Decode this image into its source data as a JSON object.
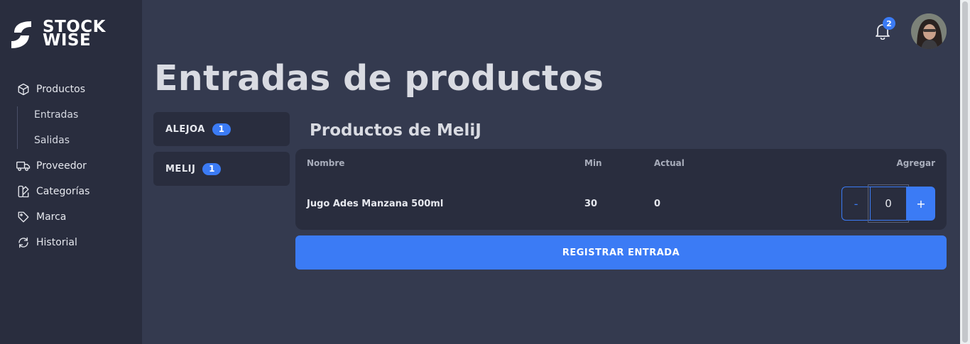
{
  "brand": {
    "line1": "STOCK",
    "line2": "WISE"
  },
  "sidebar": {
    "items": [
      {
        "label": "Productos",
        "icon": "box-icon"
      },
      {
        "label": "Entradas"
      },
      {
        "label": "Salidas"
      },
      {
        "label": "Proveedor",
        "icon": "truck-icon"
      },
      {
        "label": "Categorías",
        "icon": "category-icon"
      },
      {
        "label": "Marca",
        "icon": "tag-icon"
      },
      {
        "label": "Historial",
        "icon": "history-icon"
      }
    ]
  },
  "header": {
    "notifications": "2"
  },
  "page": {
    "title": "Entradas de productos"
  },
  "suppliers": [
    {
      "name": "ALEJOA",
      "count": "1"
    },
    {
      "name": "MELIJ",
      "count": "1"
    }
  ],
  "products_section": {
    "title": "Productos de MeliJ",
    "columns": {
      "name": "Nombre",
      "min": "Min",
      "current": "Actual",
      "add": "Agregar"
    },
    "rows": [
      {
        "name": "Jugo Ades Manzana 500ml",
        "min": "30",
        "current": "0",
        "add_value": "0"
      }
    ],
    "stepper": {
      "minus": "-",
      "plus": "+"
    }
  },
  "register_button": "REGISTRAR ENTRADA",
  "colors": {
    "accent": "#3b7bf5",
    "sidebar": "#292d3e",
    "background": "#343a4f"
  }
}
